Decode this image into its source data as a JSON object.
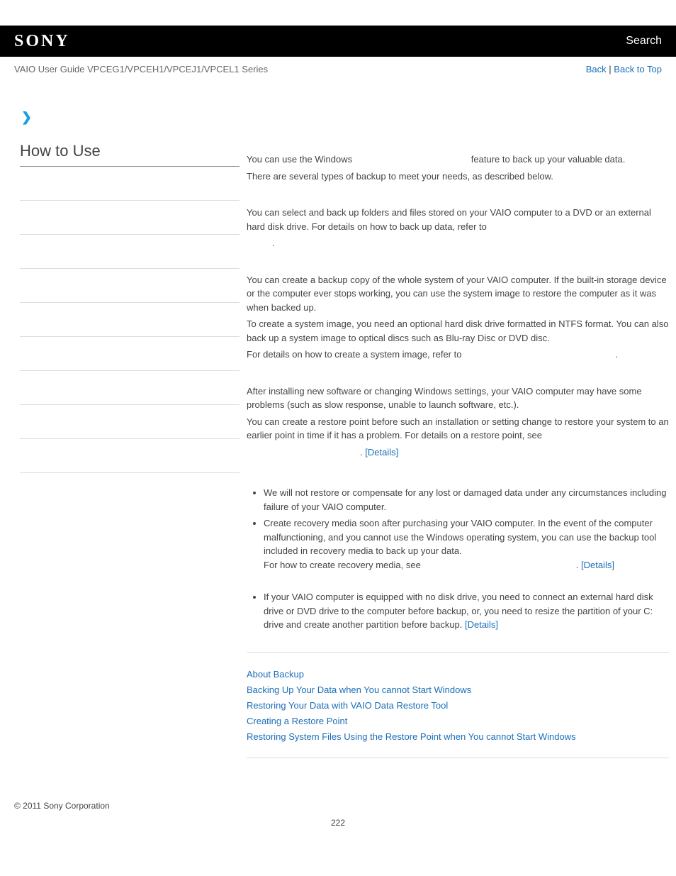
{
  "topbar": {
    "logo": "SONY",
    "search": "Search"
  },
  "subbar": {
    "title": "VAIO User Guide VPCEG1/VPCEH1/VPCEJ1/VPCEL1 Series",
    "back": "Back",
    "back_to_top": "Back to Top"
  },
  "sidebar": {
    "heading": "How to Use"
  },
  "main": {
    "intro1_a": "You can use the Windows ",
    "intro1_b": " feature to back up your valuable data.",
    "intro2": "There are several types of backup to meet your needs, as described below.",
    "p1": "You can select and back up folders and files stored on your VAIO computer to a DVD or an external hard disk drive. For details on how to back up data, refer to ",
    "p1_end": ".",
    "p2a": "You can create a backup copy of the whole system of your VAIO computer. If the built-in storage device or the computer ever stops working, you can use the system image to restore the computer as it was when backed up.",
    "p2b": "To create a system image, you need an optional hard disk drive formatted in NTFS format. You can also back up a system image to optical discs such as Blu-ray Disc or DVD disc.",
    "p2c_a": "For details on how to create a system image, refer to ",
    "p2c_b": ".",
    "p3a": "After installing new software or changing Windows settings, your VAIO computer may have some problems (such as slow response, unable to launch software, etc.).",
    "p3b": "You can create a restore point before such an installation or setting change to restore your system to an earlier point in time if it has a problem. For details on a restore point, see ",
    "p3b_end": ". ",
    "details": "[Details]",
    "note1": "We will not restore or compensate for any lost or damaged data under any circumstances including failure of your VAIO computer.",
    "note2a": "Create recovery media soon after purchasing your VAIO computer. In the event of the computer malfunctioning, and you cannot use the Windows operating system, you can use the backup tool included in recovery media to back up your data.",
    "note2b_a": "For how to create recovery media, see ",
    "note2b_b": ". ",
    "note3_a": "If your VAIO computer is equipped with no disk drive, you need to connect an external hard disk drive or DVD drive to the computer before backup, or, you need to resize the partition of your C: drive and create another partition before backup. ",
    "related": {
      "r1": "About Backup",
      "r2": "Backing Up Your Data when You cannot Start Windows",
      "r3": "Restoring Your Data with VAIO Data Restore Tool",
      "r4": "Creating a Restore Point",
      "r5": "Restoring System Files Using the Restore Point when You cannot Start Windows"
    }
  },
  "footer": {
    "copyright": "© 2011 Sony Corporation",
    "page": "222"
  }
}
